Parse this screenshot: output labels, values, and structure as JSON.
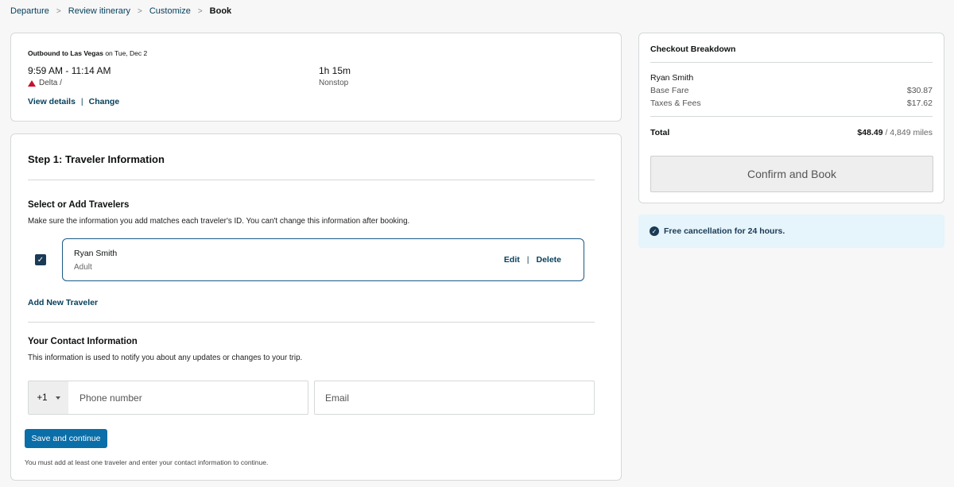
{
  "breadcrumb": {
    "items": [
      "Departure",
      "Review itinerary",
      "Customize",
      "Book"
    ],
    "separator": ">"
  },
  "flight": {
    "title_bold": "Outbound to Las Vegas",
    "title_date": "on Tue, Dec 2",
    "time": "9:59 AM - 11:14 AM",
    "airline": "Delta /",
    "duration": "1h 15m",
    "stops": "Nonstop",
    "view_details": "View details",
    "pipe": "|",
    "change": "Change"
  },
  "traveler": {
    "step_title": "Step 1: Traveler Information",
    "select_title": "Select or Add Travelers",
    "select_desc": "Make sure the information you add matches each traveler's ID. You can't change this information after booking.",
    "checkbox_mark": "✓",
    "traveler_name": "Ryan Smith",
    "traveler_type": "Adult",
    "edit": "Edit",
    "pipe": "|",
    "delete": "Delete",
    "add_new": "Add New Traveler",
    "contact_title": "Your Contact Information",
    "contact_desc": "This information is used to notify you about any updates or changes to your trip.",
    "country_code": "+1",
    "phone_placeholder": "Phone number",
    "email_placeholder": "Email",
    "save_button": "Save and continue",
    "note": "You must add at least one traveler and enter your contact information to continue."
  },
  "summary": {
    "title": "Checkout Breakdown",
    "passenger": "Ryan Smith",
    "base_fare_label": "Base Fare",
    "base_fare_value": "$30.87",
    "taxes_label": "Taxes & Fees",
    "taxes_value": "$17.62",
    "total_label": "Total",
    "total_value": "$48.49",
    "total_miles": "/ 4,849 miles",
    "confirm_button": "Confirm and Book"
  },
  "cancellation": {
    "icon": "check-circle-icon",
    "icon_glyph": "✓",
    "text": "Free cancellation for 24 hours."
  },
  "colors": {
    "link": "#06405c",
    "primary_button": "#0a6ea8",
    "checkbox": "#1b3a55",
    "delta_logo": "#c8102e",
    "banner_bg": "#e6f4fb"
  }
}
